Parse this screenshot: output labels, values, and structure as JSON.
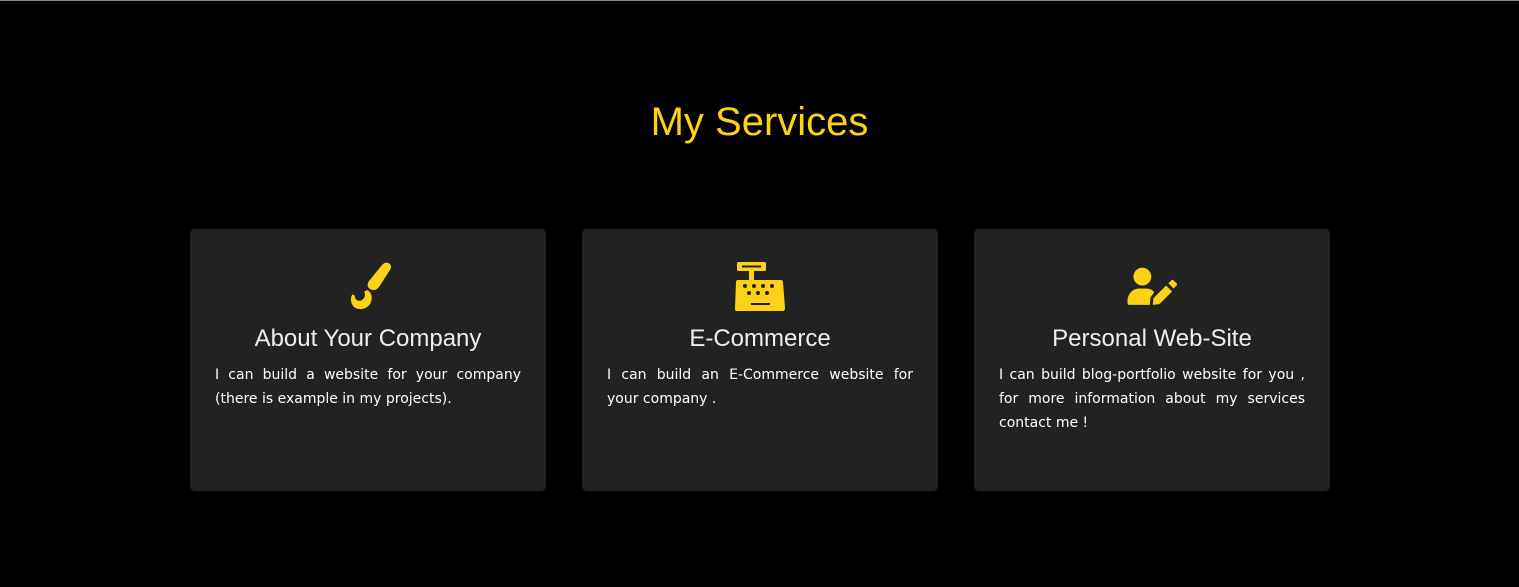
{
  "section": {
    "title": "My Services"
  },
  "accent_color": "#fcd116",
  "cards": [
    {
      "icon": "paintbrush-icon",
      "title": "About Your Company",
      "text": "I can build a website for your company (there is example in my projects)."
    },
    {
      "icon": "cash-register-icon",
      "title": "E-Commerce",
      "text": "I can build an E-Commerce website for your company ."
    },
    {
      "icon": "user-pen-icon",
      "title": "Personal Web-Site",
      "text": "I can build blog-portfolio website for you , for more information about my services contact me !"
    }
  ]
}
